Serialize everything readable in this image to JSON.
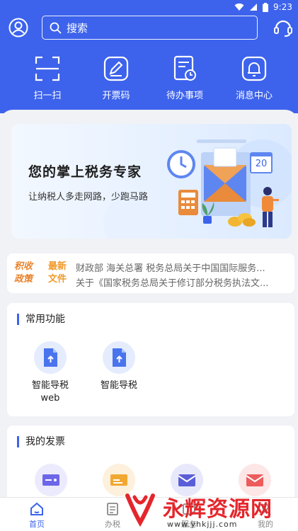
{
  "status": {
    "time": "9:23"
  },
  "search": {
    "placeholder": "搜索"
  },
  "quick_actions": [
    {
      "label": "扫一扫",
      "icon": "scan-icon"
    },
    {
      "label": "开票码",
      "icon": "invoice-code-icon"
    },
    {
      "label": "待办事项",
      "icon": "todo-icon"
    },
    {
      "label": "消息中心",
      "icon": "bell-icon"
    }
  ],
  "banner": {
    "title": "您的掌上税务专家",
    "subtitle": "让纳税人多走网路，少跑马路",
    "calendar_day": "20"
  },
  "news": {
    "badge_line1": "积收",
    "badge_line2": "政策",
    "label_line1": "最新",
    "label_line2": "文件",
    "items": [
      "财政部 海关总署 税务总局关于中国国际服务...",
      "关于《国家税务总局关于修订部分税务执法文..."
    ]
  },
  "common": {
    "title": "常用功能",
    "items": [
      {
        "label": "智能导税web",
        "line1": "智能导税",
        "line2": "web"
      },
      {
        "label": "智能导税",
        "line1": "智能导税",
        "line2": ""
      }
    ]
  },
  "invoices": {
    "title": "我的发票"
  },
  "tabs": [
    {
      "label": "首页",
      "icon": "home-icon",
      "active": true
    },
    {
      "label": "办税",
      "icon": "document-icon",
      "active": false
    },
    {
      "label": "服务",
      "icon": "service-icon",
      "active": false
    },
    {
      "label": "我的",
      "icon": "user-icon",
      "active": false
    }
  ],
  "watermark": {
    "title": "永辉资源网",
    "url": "www.yhkjjj.com"
  },
  "colors": {
    "primary": "#3d63ec",
    "accent": "#e8822a",
    "watermark": "#e4262c"
  }
}
